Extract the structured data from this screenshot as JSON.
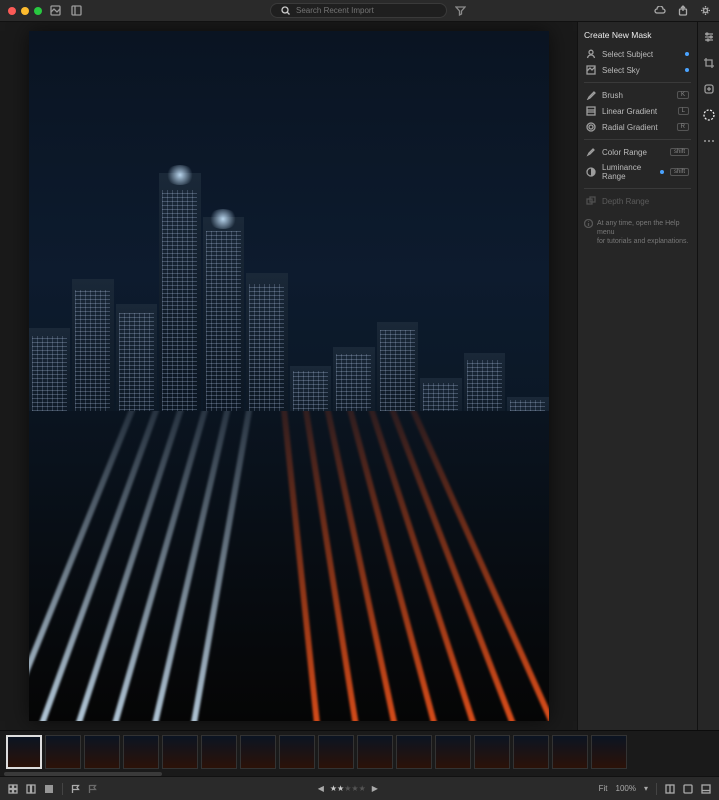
{
  "topbar": {
    "search_placeholder": "Search Recent Import"
  },
  "mask_panel": {
    "title": "Create New Mask",
    "items": [
      {
        "label": "Select Subject",
        "icon": "person-icon",
        "new_dot": true
      },
      {
        "label": "Select Sky",
        "icon": "sky-icon",
        "new_dot": true
      },
      {
        "label": "Brush",
        "icon": "brush-icon",
        "badge": "K"
      },
      {
        "label": "Linear Gradient",
        "icon": "linear-gradient-icon",
        "badge": "L"
      },
      {
        "label": "Radial Gradient",
        "icon": "radial-gradient-icon",
        "badge": "R"
      },
      {
        "label": "Color Range",
        "icon": "eyedropper-icon",
        "badge": "shift"
      },
      {
        "label": "Luminance Range",
        "icon": "luminance-icon",
        "new_dot": true,
        "badge": "shift"
      },
      {
        "label": "Depth Range",
        "icon": "depth-icon",
        "disabled": true
      }
    ],
    "hint_line1": "At any time, open the Help menu",
    "hint_line2": "for tutorials and explanations."
  },
  "bottombar": {
    "fit_label": "Fit",
    "zoom_label": "100%",
    "rating_filled": 2,
    "rating_total": 5
  },
  "filmstrip": {
    "count": 16,
    "selected": 0
  }
}
